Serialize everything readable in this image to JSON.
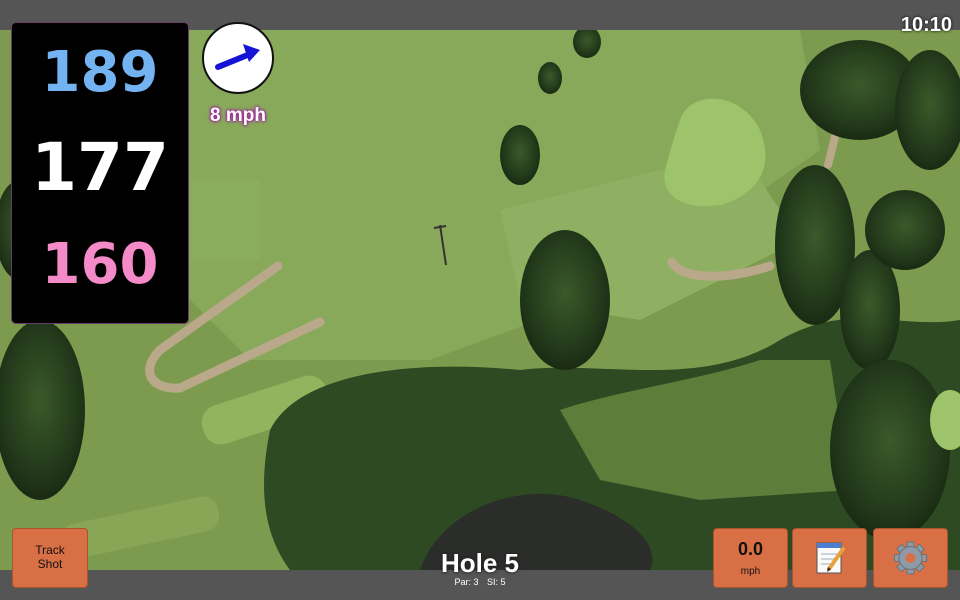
{
  "status": {
    "time": "10:10"
  },
  "distances": {
    "back": "189",
    "middle": "177",
    "front": "160"
  },
  "wind": {
    "speed_label": "8 mph",
    "direction_icon": "arrow-icon",
    "arrow_color": "#1414d6"
  },
  "hole": {
    "title": "Hole 5",
    "par_label": "Par: 3",
    "si_label": "SI: 5"
  },
  "buttons": {
    "track_shot_line1": "Track",
    "track_shot_line2": "Shot",
    "speed_value": "0.0",
    "speed_unit": "mph",
    "scorecard_icon": "notepad-pencil-icon",
    "settings_icon": "gear-icon"
  },
  "colors": {
    "back": "#74b3f2",
    "middle": "#ffffff",
    "front": "#f48ac7",
    "button": "#d97045",
    "wind_glow": "#a020a0"
  }
}
